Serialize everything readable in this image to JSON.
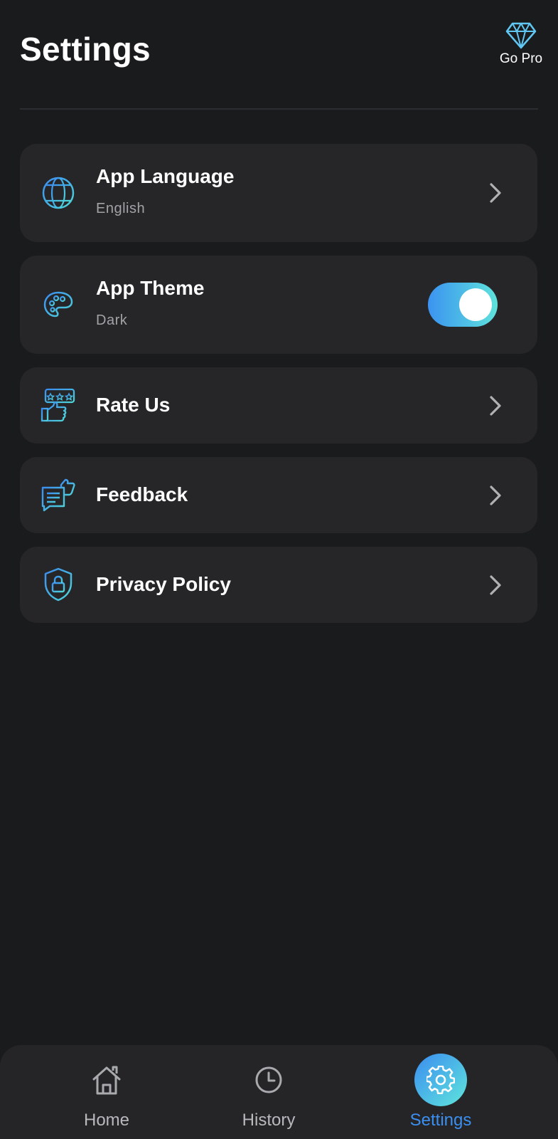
{
  "header": {
    "title": "Settings",
    "go_pro_label": "Go Pro",
    "go_pro_icon": "diamond-icon"
  },
  "settings": {
    "language": {
      "title": "App Language",
      "value": "English",
      "icon": "globe-icon"
    },
    "theme": {
      "title": "App Theme",
      "value": "Dark",
      "icon": "palette-icon",
      "toggle_on": true
    },
    "rate": {
      "title": "Rate Us",
      "icon": "rate-us-icon"
    },
    "feedback": {
      "title": "Feedback",
      "icon": "feedback-icon"
    },
    "privacy": {
      "title": "Privacy Policy",
      "icon": "shield-lock-icon"
    }
  },
  "bottom_nav": {
    "items": [
      {
        "label": "Home",
        "icon": "home-icon",
        "active": false
      },
      {
        "label": "History",
        "icon": "clock-icon",
        "active": false
      },
      {
        "label": "Settings",
        "icon": "gear-icon",
        "active": true
      }
    ]
  },
  "colors": {
    "background": "#1a1b1d",
    "card": "#262628",
    "accent_start": "#3b8cf0",
    "accent_end": "#5fe6dc",
    "active_label": "#3a8ff0",
    "subtitle": "#a2a3a6"
  }
}
